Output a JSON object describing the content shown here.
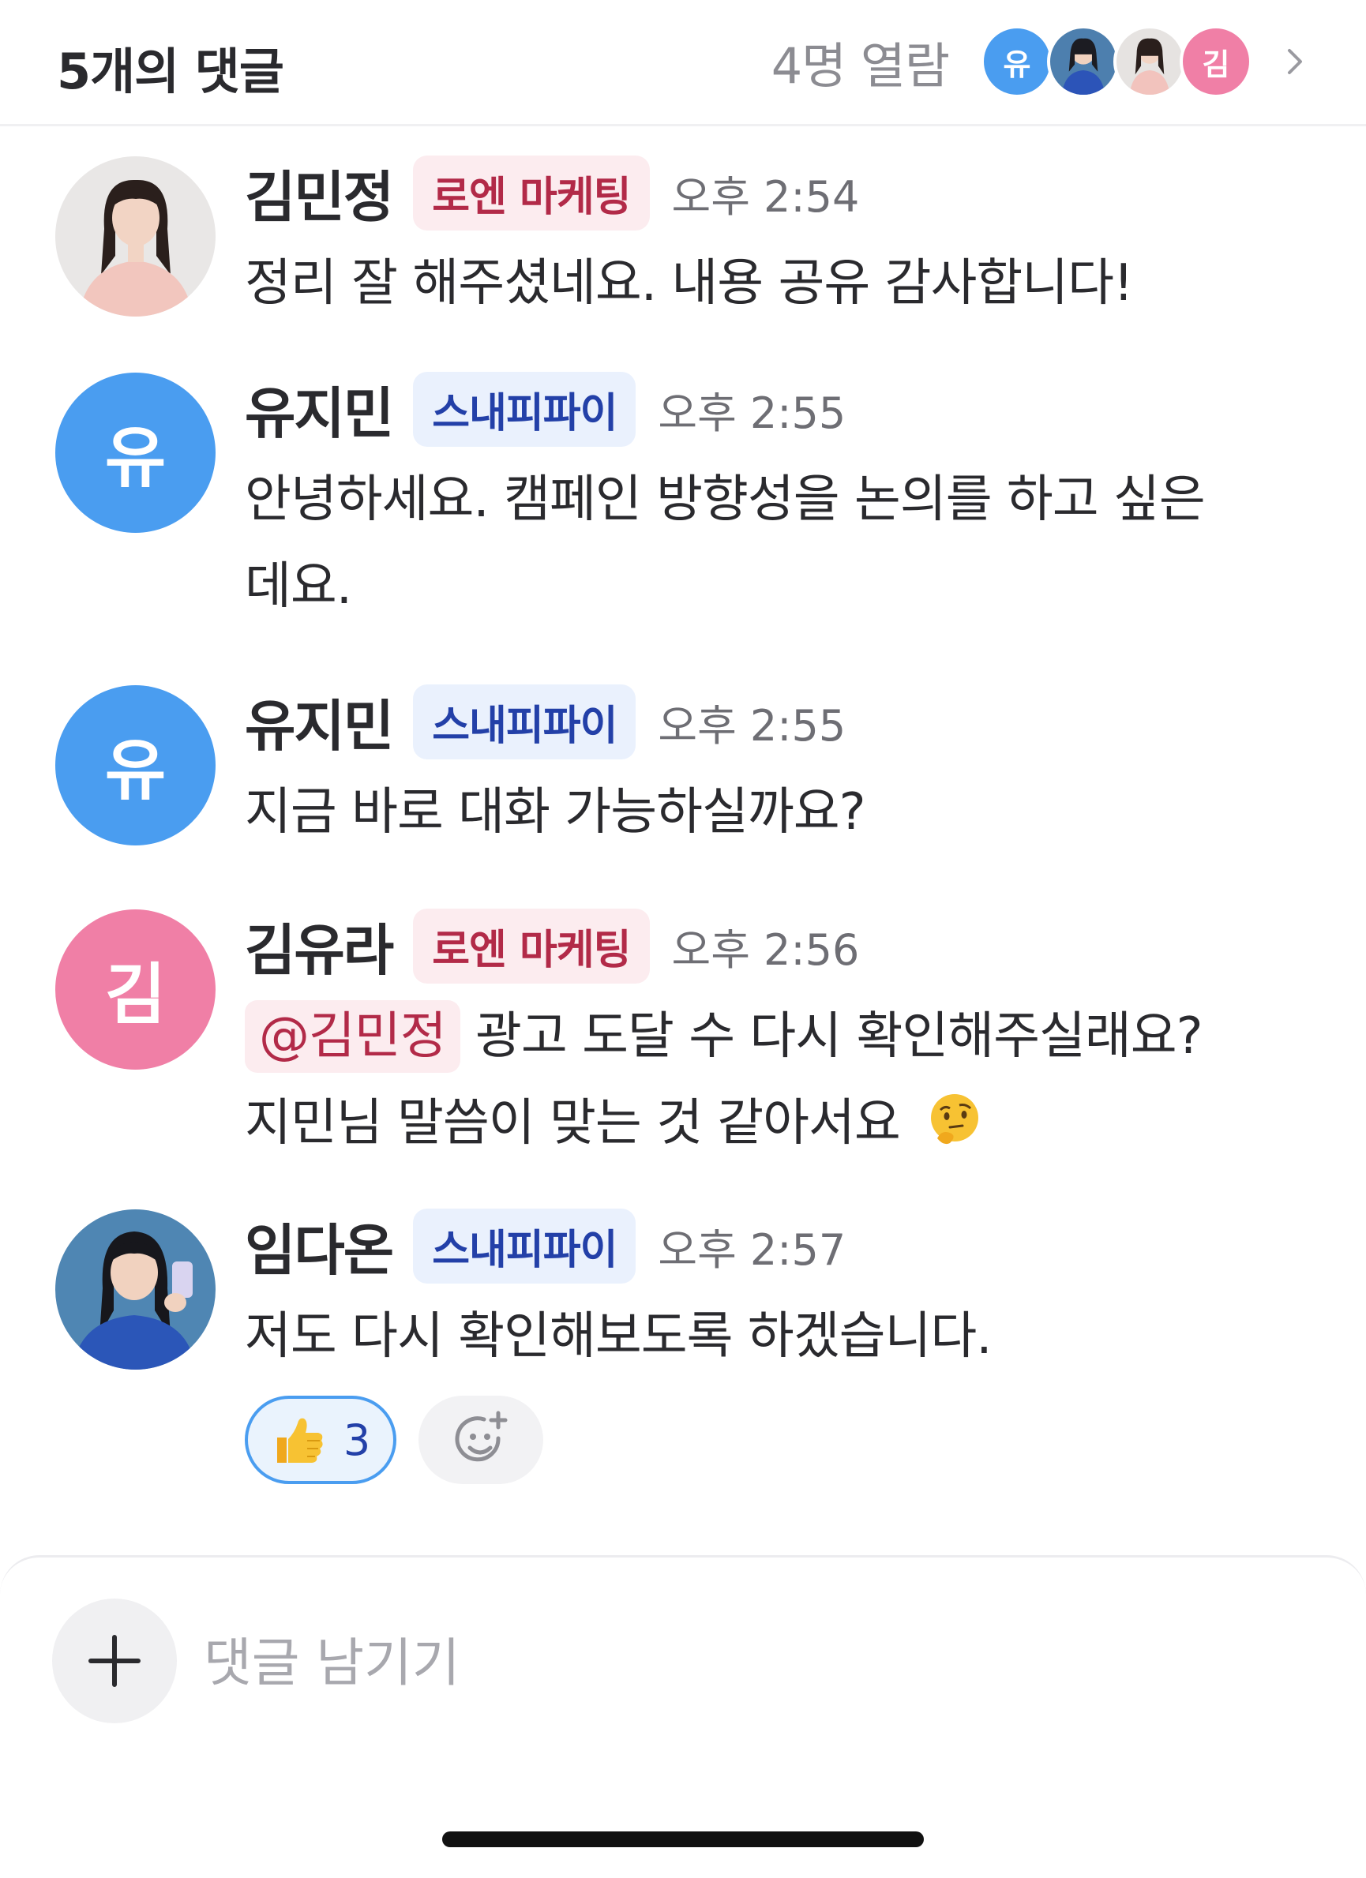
{
  "header": {
    "title": "5개의 댓글",
    "viewers_label": "4명 열람",
    "viewer_avatars": [
      {
        "initial": "유",
        "color": "#4a9df0"
      },
      {
        "initial": "",
        "color": "#3a6fa0"
      },
      {
        "initial": "",
        "color": "#d8c6bd"
      },
      {
        "initial": "김",
        "color": "#f07fa6"
      }
    ]
  },
  "comments": [
    {
      "name": "김민정",
      "badge": "로엔 마케팅",
      "time": "오후 2:54",
      "text": "정리 잘 해주셨네요. 내용 공유 감사합니다!"
    },
    {
      "name": "유지민",
      "badge": "스내피파이",
      "time": "오후 2:55",
      "avatar_initial": "유",
      "text_line1": "안녕하세요. 캠페인 방향성을 논의를 하고 싶은",
      "text_line2": "데요."
    },
    {
      "name": "유지민",
      "badge": "스내피파이",
      "time": "오후 2:55",
      "avatar_initial": "유",
      "text": "지금 바로 대화 가능하실까요?"
    },
    {
      "name": "김유라",
      "badge": "로엔 마케팅",
      "time": "오후 2:56",
      "avatar_initial": "김",
      "mention": "@김민정",
      "text_line1": "광고 도달 수 다시 확인해주실래요?",
      "text_line2": "지민님 말씀이 맞는 것 같아서요"
    },
    {
      "name": "임다온",
      "badge": "스내피파이",
      "time": "오후 2:57",
      "text": "저도 다시 확인해보도록 하겠습니다.",
      "reaction": {
        "emoji": "thumbs-up",
        "count": "3"
      }
    }
  ],
  "input": {
    "placeholder": "댓글 남기기"
  },
  "colors": {
    "accent_blue": "#4a9df0",
    "accent_pink": "#f07fa6",
    "badge_red": "#b22a48",
    "badge_blue": "#2340a8"
  }
}
